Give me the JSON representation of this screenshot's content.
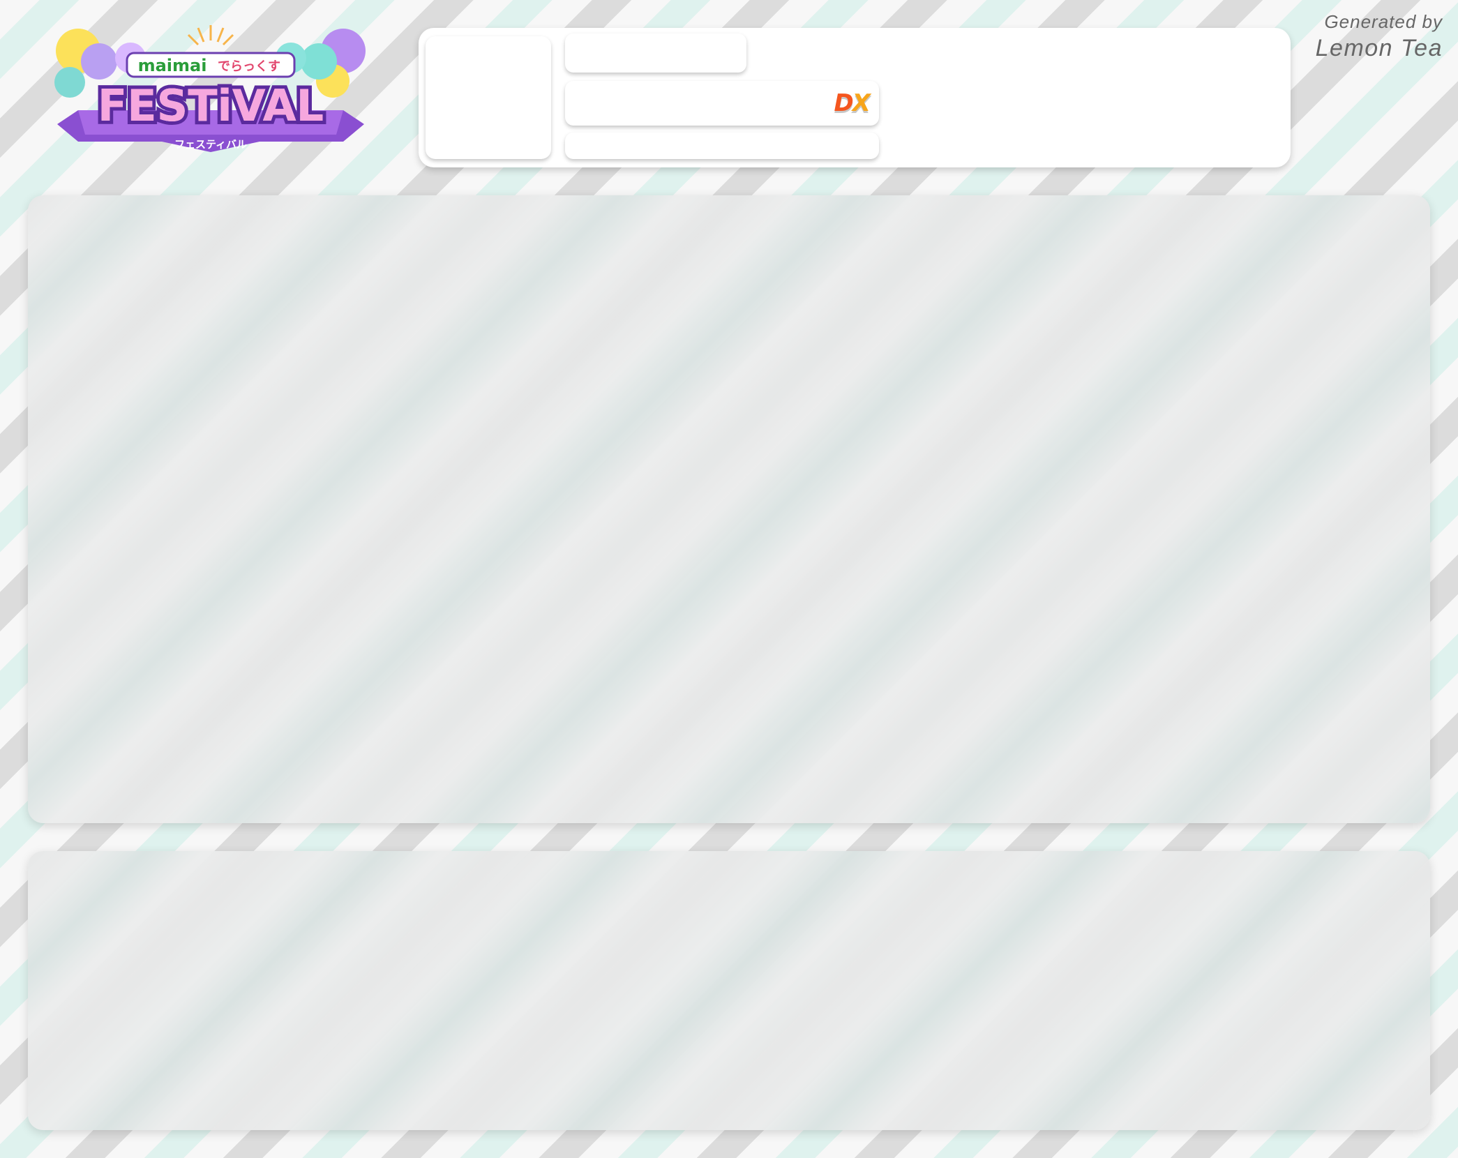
{
  "logo": {
    "brand": "maimai",
    "subtitle_jp": "でらっくす",
    "title": "FESTiVAL",
    "kana": "フェスティバル"
  },
  "profile": {
    "badge_left": "D",
    "badge_right": "X"
  },
  "credit": {
    "line1": "Generated by",
    "line2": "Lemon Tea"
  },
  "colors": {
    "accent_orange": "#f5561f",
    "accent_yellow": "#f7a51b",
    "logo_purple": "#8a4fd1",
    "stripe_mint": "#dff2ee",
    "stripe_grey": "#dcdcdc"
  }
}
